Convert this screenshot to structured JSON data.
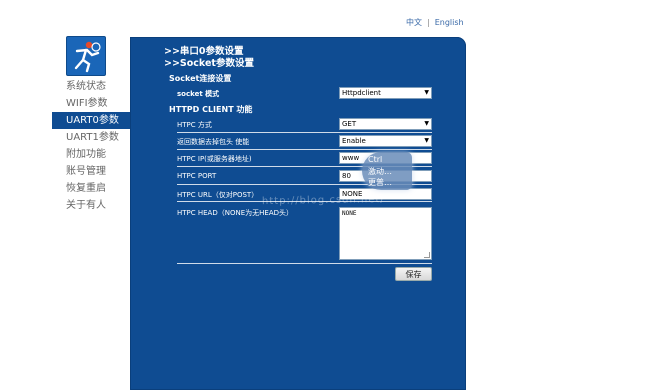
{
  "language": {
    "zh": "中文",
    "separator": "|",
    "en": "English"
  },
  "sidebar": {
    "items": [
      {
        "label": "系统状态"
      },
      {
        "label": "WIFI参数"
      },
      {
        "label": "UART0参数"
      },
      {
        "label": "UART1参数"
      },
      {
        "label": "附加功能"
      },
      {
        "label": "账号管理"
      },
      {
        "label": "恢复重启"
      },
      {
        "label": "关于有人"
      }
    ],
    "active_index": 2
  },
  "breadcrumb": {
    "line1": ">>串口0参数设置",
    "line2": ">>Socket参数设置"
  },
  "socket_section": {
    "title": "Socket连接设置",
    "mode_label": "socket 模式",
    "mode_value": "Httpdclient"
  },
  "httpd_section": {
    "title": "HTTPD CLIENT 功能",
    "method_label": "HTPC 方式",
    "method_value": "GET",
    "strip_label": "返回数据去掉包头 使能",
    "strip_value": "Enable",
    "ip_label": "HTPC IP(或服务器地址)",
    "ip_value": "www",
    "port_label": "HTPC PORT",
    "port_value": "80",
    "url_label": "HTPC URL（仅对POST）",
    "url_value": "NONE",
    "head_label": "HTPC HEAD（NONE为无HEAD头）",
    "head_value": "NONE"
  },
  "save_label": "保存",
  "tooltip": {
    "line1": "Ctrl",
    "line2": "激动…",
    "line3": "更普…"
  },
  "watermark": "http://blog.csdn.net/"
}
